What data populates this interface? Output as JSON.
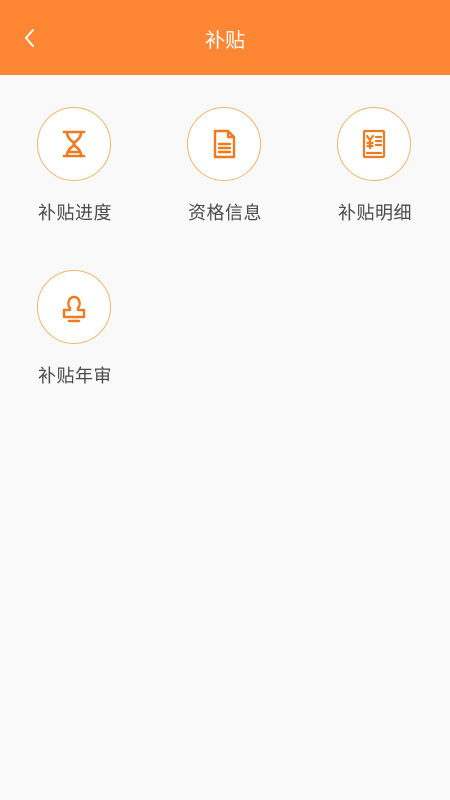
{
  "colors": {
    "header_bg": "#ff8632",
    "icon_stroke": "#f07a20",
    "ring": "#f4b46a",
    "label": "#4a4a4a",
    "page_bg": "#f9f9f9"
  },
  "header": {
    "title": "补贴",
    "back_icon": "chevron-left-icon"
  },
  "menu": {
    "items": [
      {
        "label": "补贴进度",
        "icon": "hourglass-icon"
      },
      {
        "label": "资格信息",
        "icon": "document-icon"
      },
      {
        "label": "补贴明细",
        "icon": "receipt-yen-icon"
      },
      {
        "label": "补贴年审",
        "icon": "stamp-icon"
      }
    ]
  }
}
